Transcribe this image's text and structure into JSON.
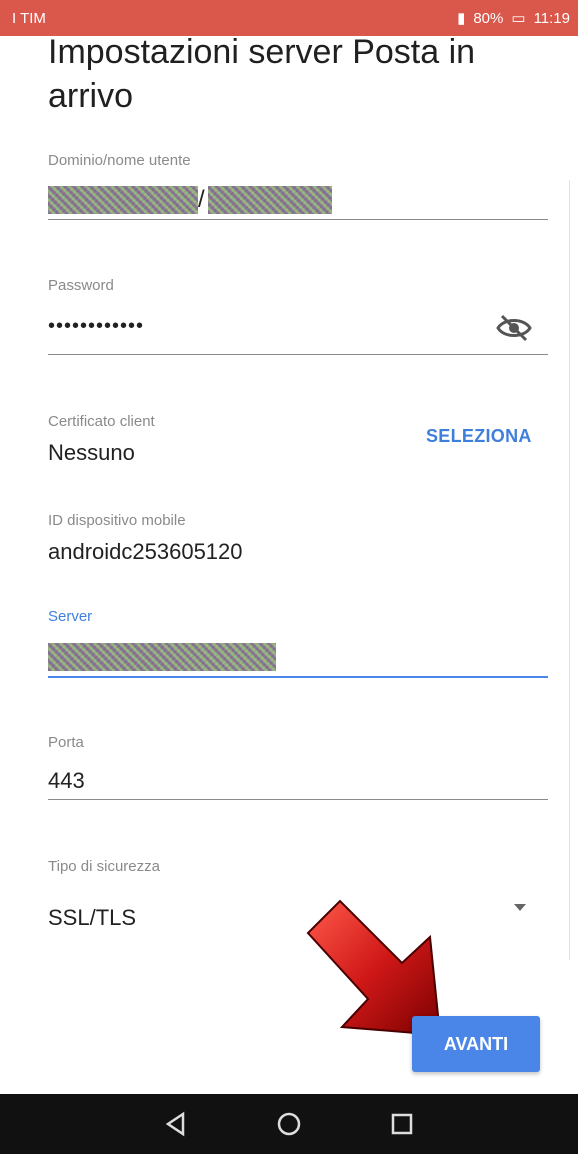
{
  "status_bar": {
    "carrier": "I TIM",
    "battery": "80%",
    "time": "11:19"
  },
  "header": {
    "title": "Impostazioni server Posta in arrivo"
  },
  "fields": {
    "domain_user": {
      "label": "Dominio/nome utente",
      "separator": "/"
    },
    "password": {
      "label": "Password",
      "value": "••••••••••••"
    },
    "client_cert": {
      "label": "Certificato client",
      "value": "Nessuno",
      "action": "SELEZIONA"
    },
    "device_id": {
      "label": "ID dispositivo mobile",
      "value": "androidc253605120"
    },
    "server": {
      "label": "Server"
    },
    "port": {
      "label": "Porta",
      "value": "443"
    },
    "security": {
      "label": "Tipo di sicurezza",
      "value": "SSL/TLS"
    }
  },
  "actions": {
    "next_label": "AVANTI"
  },
  "colors": {
    "accent": "#4a86e8",
    "status_bar": "#d9574b",
    "arrow": "#c41818"
  },
  "icons": [
    "visibility-off-icon",
    "dropdown-arrow-icon",
    "back-nav-icon",
    "home-nav-icon",
    "recents-nav-icon"
  ]
}
